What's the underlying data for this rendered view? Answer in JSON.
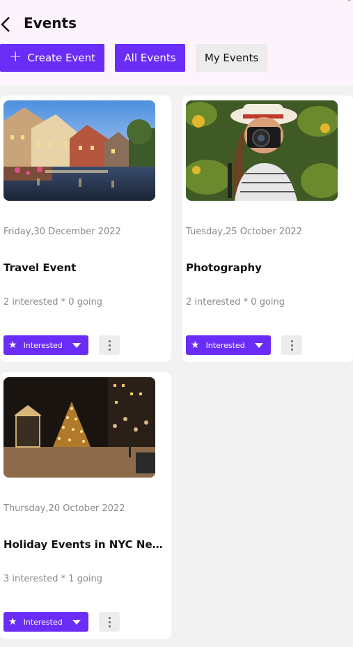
{
  "header": {
    "title": "Events",
    "back_icon": "chevron-left-icon",
    "corner_glyph": "⌕"
  },
  "toolbar": {
    "create_label": "Create Event",
    "create_icon": "plus-icon",
    "all_label": "All Events",
    "my_label": "My Events"
  },
  "colors": {
    "accent": "#6a2cf7",
    "header_bg": "#fdf3fd",
    "page_bg": "#f2f2f2"
  },
  "events": [
    {
      "date": "Friday,30 December 2022",
      "title": "Travel Event",
      "stats": "2 interested * 0 going",
      "interested_label": "Interested",
      "image": "canal-town-photo"
    },
    {
      "date": "Tuesday,25 October 2022",
      "title": "Photography",
      "stats": "2 interested * 0 going",
      "interested_label": "Interested",
      "image": "photographer-photo"
    },
    {
      "date": "Thursday,20 October 2022",
      "title": "Holiday Events in NYC New Y...",
      "stats": "3 interested * 1 going",
      "interested_label": "Interested",
      "image": "christmas-tree-plaza-photo"
    }
  ]
}
